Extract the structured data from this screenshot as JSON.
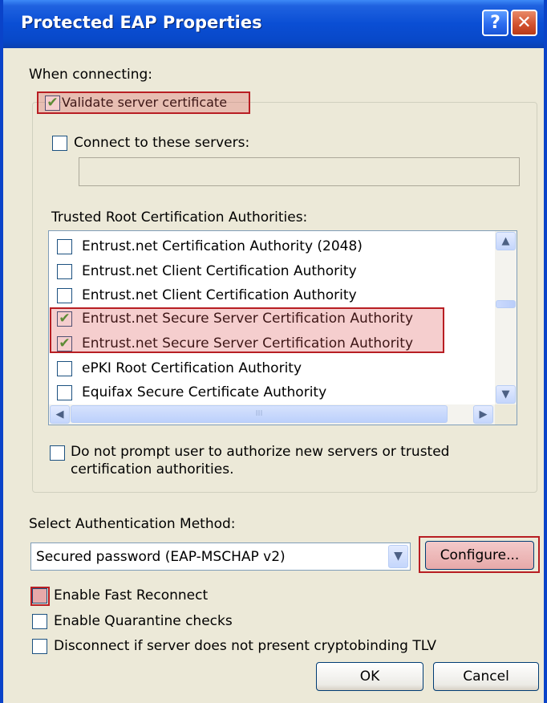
{
  "window": {
    "title": "Protected EAP Properties",
    "help_glyph": "?",
    "close_glyph": "✕"
  },
  "when_connecting": "When connecting:",
  "validate_cert": {
    "label": "Validate server certificate",
    "checked": true
  },
  "connect_servers": {
    "label": "Connect to these servers:",
    "checked": false,
    "value": ""
  },
  "trusted_root_label": "Trusted Root Certification Authorities:",
  "ca_list": [
    {
      "label": "Entrust.net Certification Authority (2048)",
      "checked": false
    },
    {
      "label": "Entrust.net Client Certification Authority",
      "checked": false
    },
    {
      "label": "Entrust.net Client Certification Authority",
      "checked": false
    },
    {
      "label": "Entrust.net Secure Server Certification Authority",
      "checked": true
    },
    {
      "label": "Entrust.net Secure Server Certification Authority",
      "checked": true
    },
    {
      "label": "ePKI Root Certification Authority",
      "checked": false
    },
    {
      "label": "Equifax Secure Certificate Authority",
      "checked": false
    }
  ],
  "scroll_icons": {
    "up": "▲",
    "down": "▼",
    "left": "◀",
    "right": "▶",
    "grip": "III"
  },
  "do_not_prompt": {
    "line1": "Do not prompt user to authorize new servers or trusted",
    "line2": "certification authorities.",
    "checked": false
  },
  "auth_method_label": "Select Authentication Method:",
  "auth_method_value": "Secured password (EAP-MSCHAP v2)",
  "configure_label": "Configure...",
  "enable_fast_reconnect": {
    "label": "Enable Fast Reconnect",
    "checked": false
  },
  "enable_quarantine": {
    "label": "Enable Quarantine checks",
    "checked": false
  },
  "disconnect_tlv": {
    "label": "Disconnect if server does not present cryptobinding TLV",
    "checked": false
  },
  "ok_label": "OK",
  "cancel_label": "Cancel",
  "check_glyph": "✔",
  "colors": {
    "title_bar": "#0a4ed4",
    "highlight_border": "#b81e23",
    "dialog_bg": "#ece9d8"
  }
}
